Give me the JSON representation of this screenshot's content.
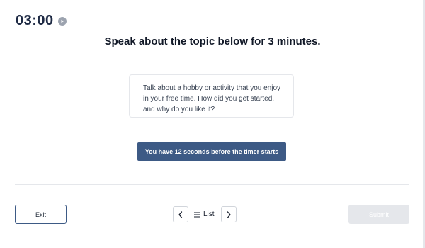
{
  "timer": {
    "value": "03:00",
    "icon": "play-icon"
  },
  "heading": "Speak about the topic below for 3 minutes.",
  "prompt": {
    "lines": [
      "Talk about a hobby or activity that you enjoy",
      "in your free time. How did you get started,",
      "and why do you like it?"
    ]
  },
  "countdown": {
    "label": "You have 12 seconds before the timer starts"
  },
  "footer": {
    "exit_label": "Exit",
    "prev_icon": "chevron-left-icon",
    "list_icon": "list-icon",
    "list_label": "List",
    "next_icon": "chevron-right-icon",
    "submit_label": "Submit",
    "submit_disabled": true
  },
  "colors": {
    "accent": "#3d5a85",
    "timer_text": "#1e2a44",
    "submit_disabled_bg": "#e5e7eb"
  }
}
